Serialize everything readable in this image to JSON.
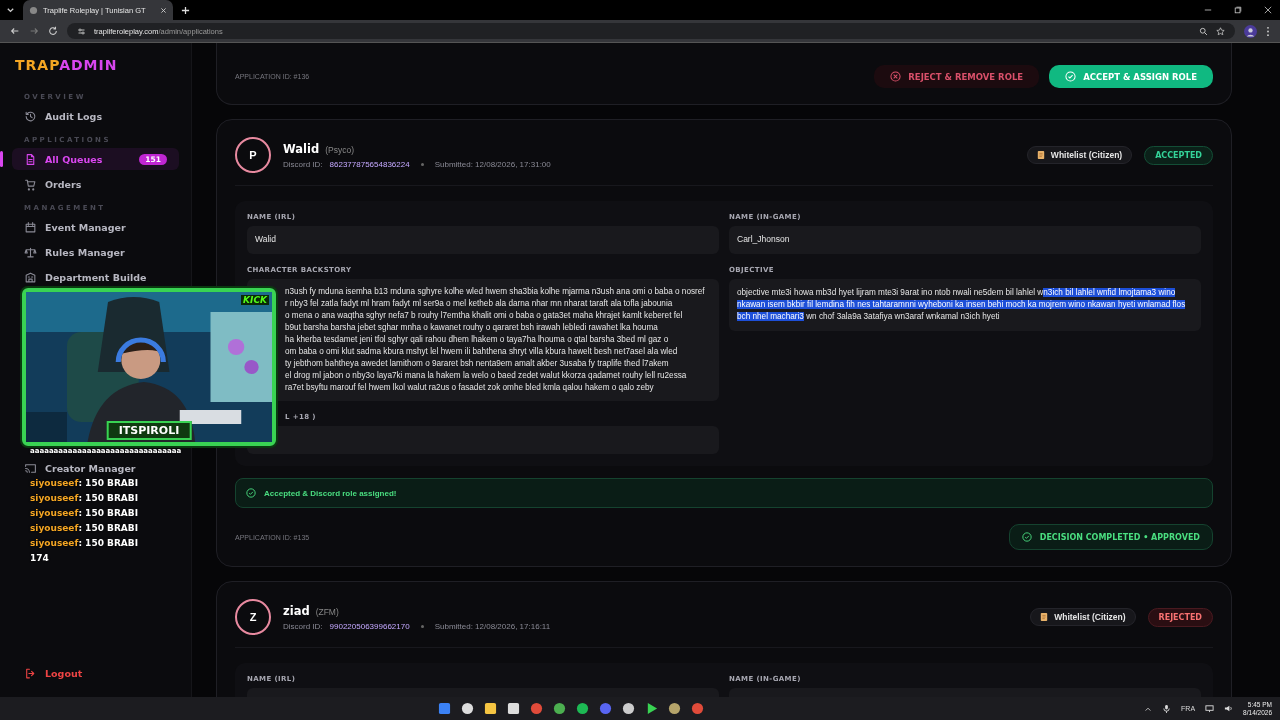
{
  "browser": {
    "tab_title": "Traplife Roleplay | Tunisian GT",
    "url_host": "trapliferoleplay.com",
    "url_path": "/admin/applications"
  },
  "sidebar": {
    "logo_first": "TRAP",
    "logo_second": "ADMIN",
    "sections": [
      {
        "title": "OVERVIEW",
        "items": [
          {
            "label": "Audit Logs",
            "selected": false
          }
        ]
      },
      {
        "title": "APPLICATIONS",
        "items": [
          {
            "label": "All Queues",
            "selected": true,
            "badge": "151"
          },
          {
            "label": "Orders",
            "selected": false
          }
        ]
      },
      {
        "title": "MANAGEMENT",
        "items": [
          {
            "label": "Event Manager",
            "selected": false
          },
          {
            "label": "Rules Manager",
            "selected": false
          },
          {
            "label": "Department Builde",
            "selected": false
          }
        ]
      }
    ],
    "lower_items": [
      {
        "label": "Creator Manager",
        "selected": false
      }
    ],
    "logout": "Logout"
  },
  "applications": [
    {
      "application_id": "APPLICATION ID: #136",
      "actions": [
        {
          "label": "REJECT & REMOVE ROLE",
          "kind": "reject"
        },
        {
          "label": "ACCEPT & ASSIGN ROLE",
          "kind": "accept"
        }
      ]
    },
    {
      "applicant": {
        "initial": "P",
        "name": "Walid",
        "alias": "(Psyco)",
        "discord_label": "Discord ID:",
        "discord_id": "862377875654836224",
        "submitted": "Submitted: 12/08/2026, 17:31:00"
      },
      "type_badge": "Whitelist (Citizen)",
      "status": {
        "label": "ACCEPTED",
        "kind": "accepted"
      },
      "fields": [
        {
          "label": "NAME (IRL)",
          "kind": "text",
          "value": "Walid"
        },
        {
          "label": "NAME (IN-GAME)",
          "kind": "text",
          "value": "Carl_Jhonson"
        },
        {
          "label": "CHARACTER BACKSTORY",
          "kind": "lines",
          "lines": [
            "n3ush fy mduna isemha b13 mduna sghyre kolhe wled hwem sha3bia kolhe mjarma n3ush ana omi o baba o nosref",
            "r nby3 fel zatla fadyt ml hram fadyt ml ser9a o mel ketheb ala darna nhar mn nharat taraft ala tofla jabounia",
            "o mena o ana waqtha sghyr nefa7 b rouhy l7emtha khalit omi o baba o gata3et maha khrajet kamlt keberet fel",
            "b9ut barsha barsha jebet sghar mnha o kawanet rouhy o qararet bsh irawah lebledi rawahet lka houma",
            "ha kherba tesdamet jeni tfol sghyr qali rahou dhem lhakem o taya7ha lhouma o qtal barsha 3bed ml gaz o",
            "om baba o omi klut sadma kbura mshyt lel hwem ili bahthena shryt villa kbura hawelt besh net7asel ala wled",
            "ty jebthom bahtheya awedet lamithom o 9araret bsh nenta9em amalt akber 3usaba fy traplife thed l7akem",
            "el drog ml jabon o nby3o laya7ki mana la hakem la welo o baed zedet walut kkorza qadamet rouhy lell ru2essa",
            "ra7et bsyftu marouf fel hwem lkol walut ra2us o fasadet zok omhe bled kmla qalou hakem o qalo zeby"
          ]
        },
        {
          "label": "OBJECTIVE",
          "kind": "segments",
          "segments": [
            {
              "text": "objective mte3i howa mb3d hyet lijram mte3i 9arat ino ntob nwali ne5dem bil lahlel w",
              "selected": false
            },
            {
              "text": "n3ich bil lahlel wnfid lmojtama3 wino nkawan isem bkbir fil lemdina fih nes tahtaramnni wyheboni ka insen behi moch ka mojrem wino nkawan hyeti wnlamad flos bch nhel machari3",
              "selected": true
            },
            {
              "text": " wn chof 3ala9a 3atafiya wn3araf wnkamal n3ich hyeti",
              "selected": false
            }
          ]
        },
        {
          "label": "L +18 )",
          "kind": "covered"
        }
      ],
      "banner": "Accepted & Discord role assigned!",
      "application_id": "APPLICATION ID: #135",
      "decision": "DECISION COMPLETED • APPROVED"
    },
    {
      "applicant": {
        "initial": "Z",
        "name": "ziad",
        "alias": "(ZFM)",
        "discord_label": "Discord ID:",
        "discord_id": "990220506399662170",
        "submitted": "Submitted: 12/08/2026, 17:16:11"
      },
      "type_badge": "Whitelist (Citizen)",
      "status": {
        "label": "REJECTED",
        "kind": "rejected"
      },
      "fields": [
        {
          "label": "NAME (IRL)",
          "kind": "text"
        },
        {
          "label": "NAME (IN-GAME)",
          "kind": "text"
        }
      ]
    }
  ],
  "stream_overlay": {
    "logo": "KICK",
    "streamer": "ITSPIROLI",
    "chat": [
      {
        "text": "aaaaaaaaaaaaaaaaaaaaaaaaaaaaaaaa"
      },
      {
        "user": "siyouseef",
        "text": ": 150 BRABI"
      },
      {
        "user": "siyouseef",
        "text": ": 150 BRABI"
      },
      {
        "user": "siyouseef",
        "text": ": 150 BRABI"
      },
      {
        "user": "siyouseef",
        "text": ": 150 BRABI"
      },
      {
        "user": "siyouseef",
        "text": ": 150 BRABI"
      },
      {
        "text": "174"
      }
    ]
  },
  "taskbar": {
    "lang": "FRA",
    "time": "5:45 PM",
    "date": "8/14/2026"
  }
}
